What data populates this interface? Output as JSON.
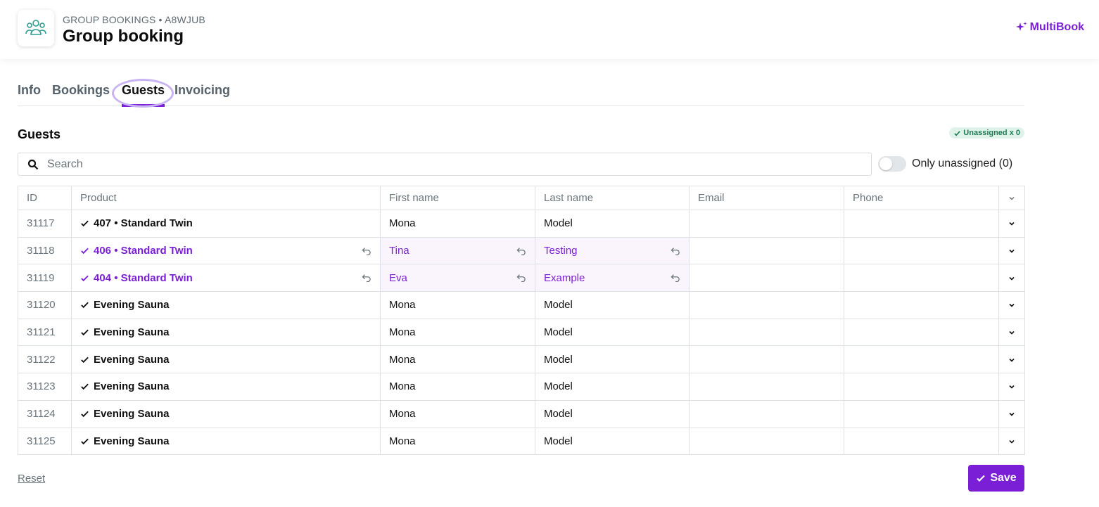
{
  "header": {
    "breadcrumb": "GROUP BOOKINGS • A8WJUB",
    "title": "Group booking",
    "brand": "MultiBook",
    "accent_color": "#7a1fd6"
  },
  "tabs": [
    {
      "label": "Info"
    },
    {
      "label": "Bookings"
    },
    {
      "label": "Guests",
      "active": true
    },
    {
      "label": "Invoicing"
    }
  ],
  "section": {
    "title": "Guests",
    "badge": "Unassigned x 0"
  },
  "search": {
    "placeholder": "Search",
    "value": ""
  },
  "filter": {
    "label": "Only unassigned (0)",
    "checked": false
  },
  "table": {
    "columns": [
      "ID",
      "Product",
      "First name",
      "Last name",
      "Email",
      "Phone"
    ],
    "rows": [
      {
        "id": "31117",
        "product": "407 • Standard Twin",
        "first": "Mona",
        "last": "Model",
        "email": "",
        "phone": "",
        "changed": false
      },
      {
        "id": "31118",
        "product": "406 • Standard Twin",
        "first": "Tina",
        "last": "Testing",
        "email": "",
        "phone": "",
        "changed": true
      },
      {
        "id": "31119",
        "product": "404 • Standard Twin",
        "first": "Eva",
        "last": "Example",
        "email": "",
        "phone": "",
        "changed": true
      },
      {
        "id": "31120",
        "product": "Evening Sauna",
        "first": "Mona",
        "last": "Model",
        "email": "",
        "phone": "",
        "changed": false
      },
      {
        "id": "31121",
        "product": "Evening Sauna",
        "first": "Mona",
        "last": "Model",
        "email": "",
        "phone": "",
        "changed": false
      },
      {
        "id": "31122",
        "product": "Evening Sauna",
        "first": "Mona",
        "last": "Model",
        "email": "",
        "phone": "",
        "changed": false
      },
      {
        "id": "31123",
        "product": "Evening Sauna",
        "first": "Mona",
        "last": "Model",
        "email": "",
        "phone": "",
        "changed": false
      },
      {
        "id": "31124",
        "product": "Evening Sauna",
        "first": "Mona",
        "last": "Model",
        "email": "",
        "phone": "",
        "changed": false
      },
      {
        "id": "31125",
        "product": "Evening Sauna",
        "first": "Mona",
        "last": "Model",
        "email": "",
        "phone": "",
        "changed": false
      }
    ]
  },
  "footer": {
    "reset_label": "Reset",
    "save_label": "Save"
  }
}
